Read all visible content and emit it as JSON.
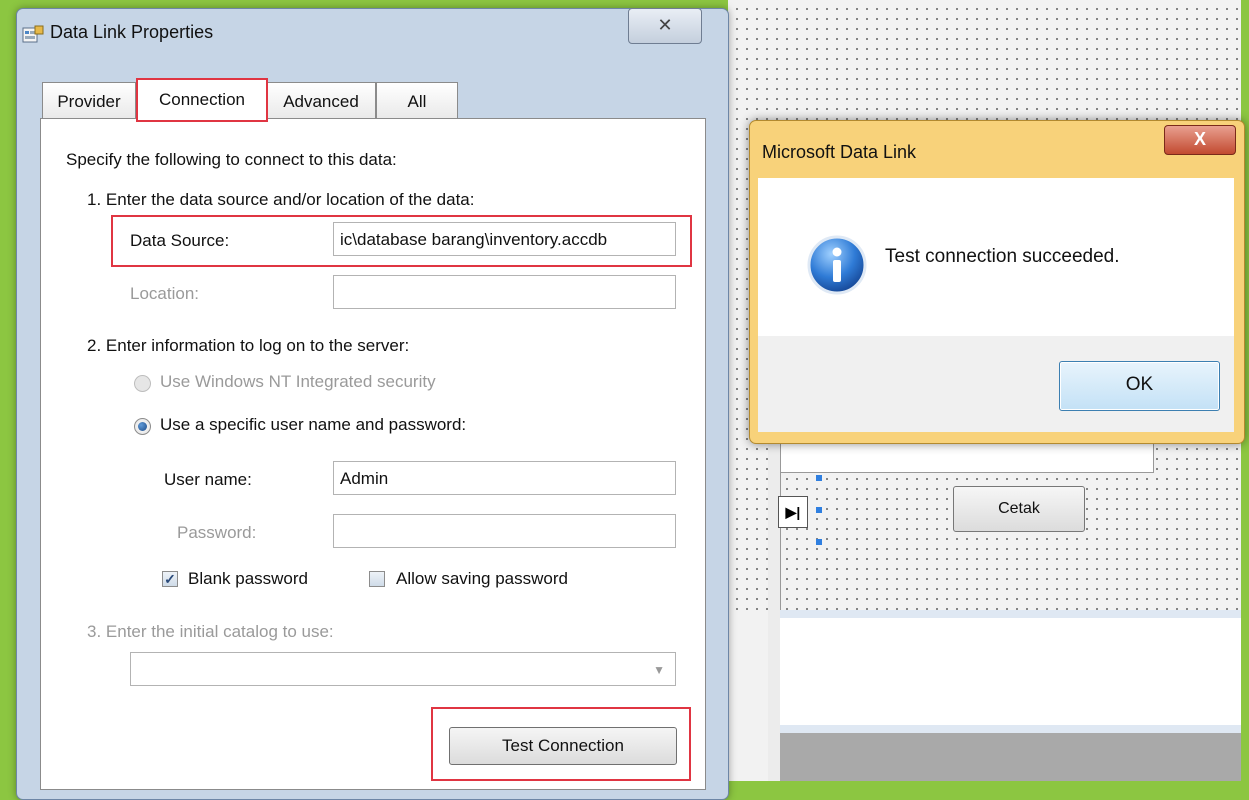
{
  "main_dialog": {
    "title": "Data Link Properties",
    "close_glyph": "✕",
    "tabs": [
      "Provider",
      "Connection",
      "Advanced",
      "All"
    ],
    "active_tab": "Connection",
    "intro": "Specify the following to connect to this data:",
    "step1": "1. Enter the data source and/or location of the data:",
    "data_source_label": "Data Source:",
    "data_source_value": "ic\\database barang\\inventory.accdb",
    "location_label": "Location:",
    "location_value": "",
    "step2": "2. Enter information to log on to the server:",
    "radio_nt": "Use Windows NT Integrated security",
    "radio_specific": "Use a specific user name and password:",
    "username_label": "User name:",
    "username_value": "Admin",
    "password_label": "Password:",
    "password_value": "",
    "blank_password_label": "Blank password",
    "blank_password_checked": true,
    "allow_saving_label": "Allow saving password",
    "allow_saving_checked": false,
    "step3": "3. Enter the initial catalog to use:",
    "catalog_value": "",
    "test_connection_label": "Test Connection"
  },
  "message_box": {
    "title": "Microsoft Data Link",
    "close_glyph": "X",
    "message": "Test connection succeeded.",
    "ok_label": "OK",
    "icon": "info-icon"
  },
  "designer": {
    "cetak_label": "Cetak",
    "nav_glyph": "▶|"
  },
  "colors": {
    "highlight_red": "#e03542",
    "background_green": "#8cc641",
    "msgbox_frame": "#f8d27a"
  }
}
